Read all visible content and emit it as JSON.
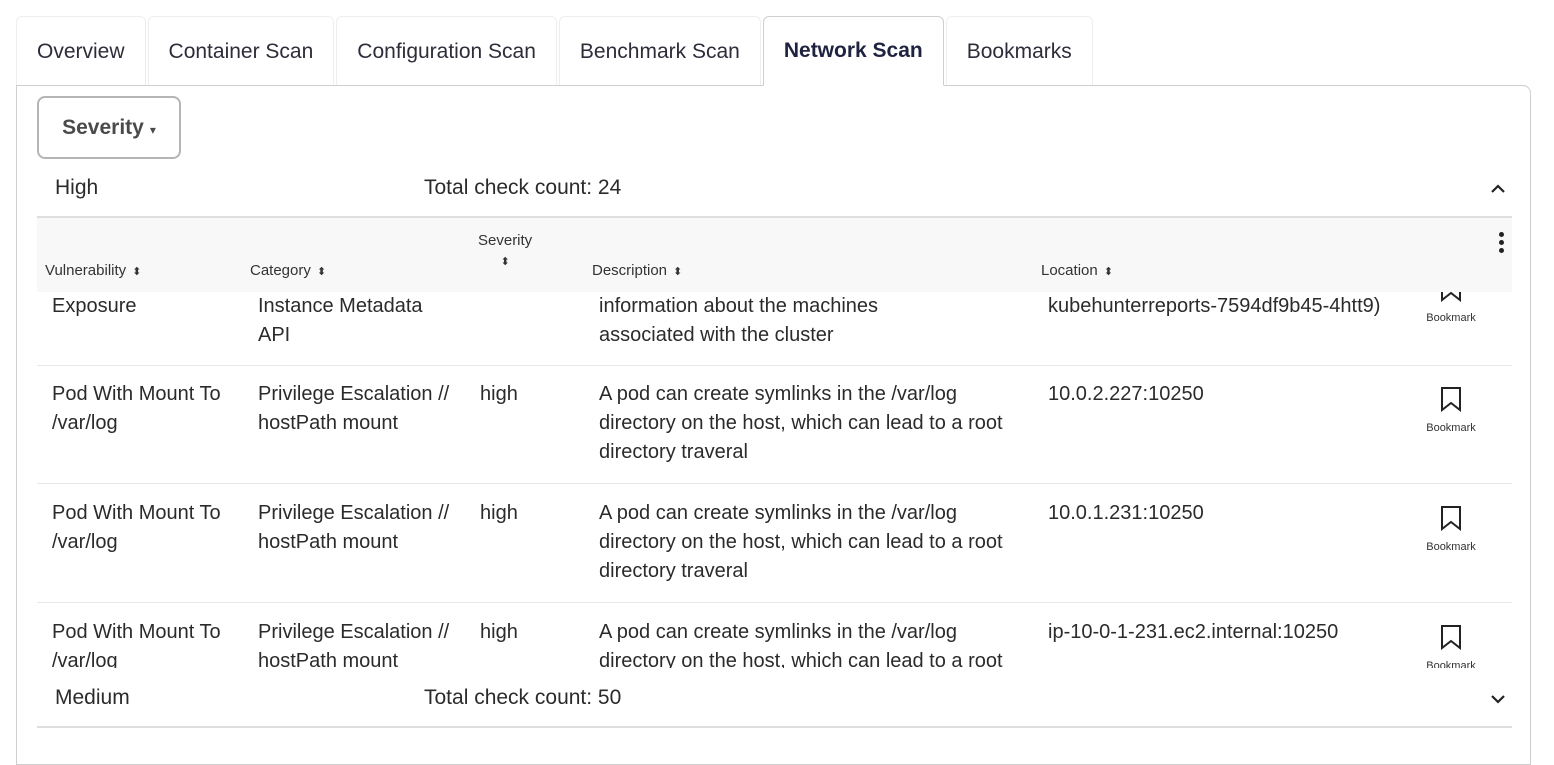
{
  "tabs": [
    {
      "label": "Overview"
    },
    {
      "label": "Container Scan"
    },
    {
      "label": "Configuration Scan"
    },
    {
      "label": "Benchmark Scan"
    },
    {
      "label": "Network Scan"
    },
    {
      "label": "Bookmarks"
    }
  ],
  "active_tab": "Network Scan",
  "filter": {
    "label": "Severity",
    "caret": "▾"
  },
  "groups": [
    {
      "name": "High",
      "count_label": "Total check count: 24",
      "chevron": "⌃"
    },
    {
      "name": "Medium",
      "count_label": "Total check count: 50",
      "chevron": "⌄"
    }
  ],
  "table": {
    "columns": [
      {
        "label": "Vulnerability",
        "sort": "⬍"
      },
      {
        "label": "Category",
        "sort": "⬍"
      },
      {
        "label": "Severity",
        "sort": "⬍"
      },
      {
        "label": "Description",
        "sort": "⬍"
      },
      {
        "label": "Location",
        "sort": "⬍"
      }
    ],
    "rows": [
      {
        "vulnerability": "Exposure",
        "category": "Instance Metadata API",
        "severity": "",
        "description": "information about the machines associated with the cluster",
        "location": "kubehunterreports-7594df9b45-4htt9)",
        "bookmark": "Bookmark"
      },
      {
        "vulnerability": "Pod With Mount To /var/log",
        "category": "Privilege Escalation // hostPath mount",
        "severity": "high",
        "description": "A pod can create symlinks in the /var/log directory on the host, which can lead to a root directory traveral",
        "location": "10.0.2.227:10250",
        "bookmark": "Bookmark"
      },
      {
        "vulnerability": "Pod With Mount To /var/log",
        "category": "Privilege Escalation // hostPath mount",
        "severity": "high",
        "description": "A pod can create symlinks in the /var/log directory on the host, which can lead to a root directory traveral",
        "location": "10.0.1.231:10250",
        "bookmark": "Bookmark"
      },
      {
        "vulnerability": "Pod With Mount To /var/log",
        "category": "Privilege Escalation // hostPath mount",
        "severity": "high",
        "description": "A pod can create symlinks in the /var/log directory on the host, which can lead to a root directory traveral",
        "location": "ip-10-0-1-231.ec2.internal:10250",
        "bookmark": "Bookmark"
      }
    ]
  }
}
